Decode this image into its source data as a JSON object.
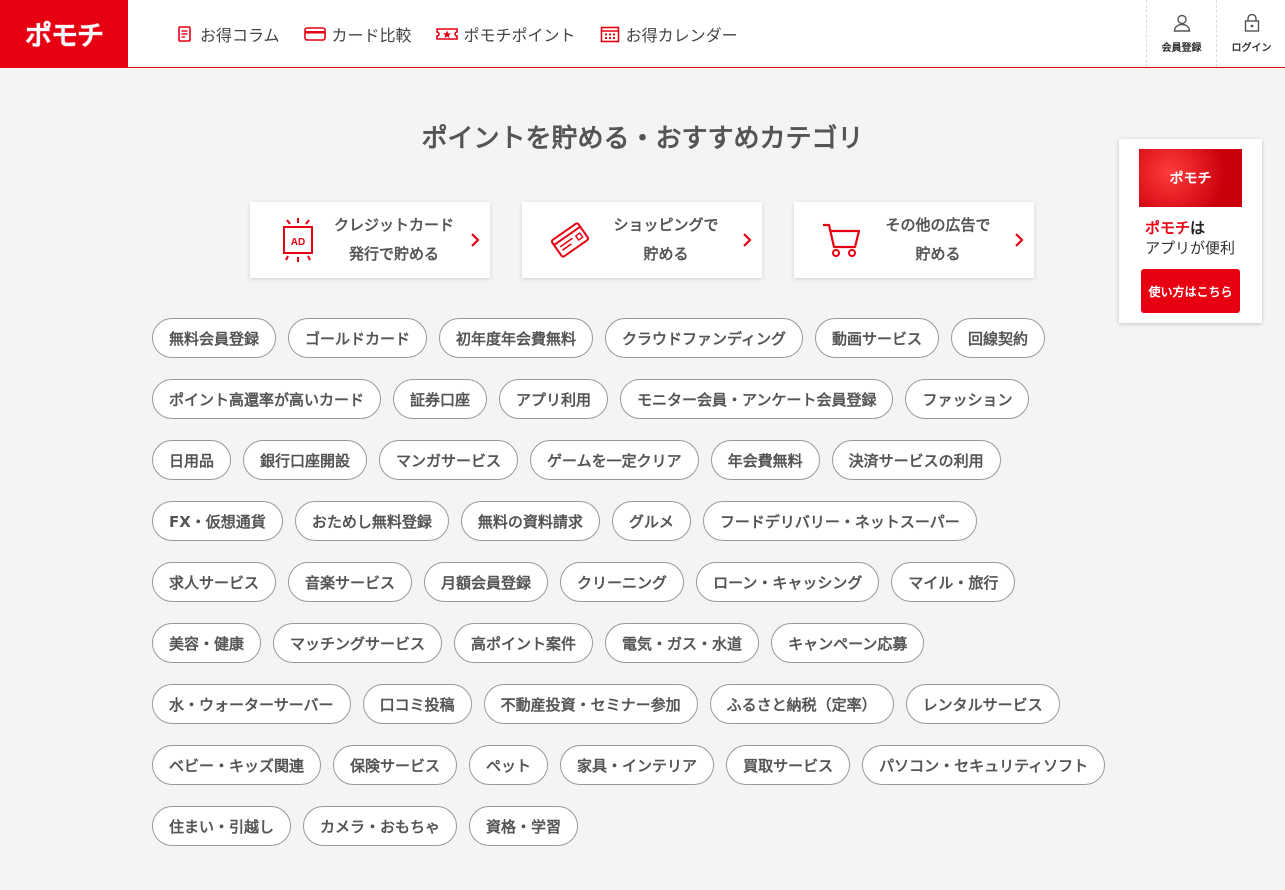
{
  "header": {
    "logo": "ポモチ",
    "nav": [
      {
        "label": "お得コラム",
        "icon": "column-icon"
      },
      {
        "label": "カード比較",
        "icon": "card-icon"
      },
      {
        "label": "ポモチポイント",
        "icon": "ticket-icon"
      },
      {
        "label": "お得カレンダー",
        "icon": "calendar-icon"
      }
    ],
    "register_label": "会員登録",
    "login_label": "ログイン"
  },
  "main": {
    "heading": "ポイントを貯める・おすすめカテゴリ",
    "feature_cards": [
      {
        "label": "クレジットカード\n発行で貯める",
        "icon": "ad-icon"
      },
      {
        "label": "ショッピングで\n貯める",
        "icon": "credit-card-icon"
      },
      {
        "label": "その他の広告で\n貯める",
        "icon": "cart-icon"
      }
    ],
    "tags": [
      "無料会員登録",
      "ゴールドカード",
      "初年度年会費無料",
      "クラウドファンディング",
      "動画サービス",
      "回線契約",
      "ポイント高還率が高いカード",
      "証券口座",
      "アプリ利用",
      "モニター会員・アンケート会員登録",
      "ファッション",
      "日用品",
      "銀行口座開設",
      "マンガサービス",
      "ゲームを一定クリア",
      "年会費無料",
      "決済サービスの利用",
      "FX・仮想通貨",
      "おためし無料登録",
      "無料の資料請求",
      "グルメ",
      "フードデリバリー・ネットスーパー",
      "求人サービス",
      "音楽サービス",
      "月額会員登録",
      "クリーニング",
      "ローン・キャッシング",
      "マイル・旅行",
      "美容・健康",
      "マッチングサービス",
      "高ポイント案件",
      "電気・ガス・水道",
      "キャンペーン応募",
      "水・ウォーターサーバー",
      "口コミ投稿",
      "不動産投資・セミナー参加",
      "ふるさと納税（定率）",
      "レンタルサービス",
      "ベビー・キッズ関連",
      "保険サービス",
      "ペット",
      "家具・インテリア",
      "買取サービス",
      "パソコン・セキュリティソフト",
      "住まい・引越し",
      "カメラ・おもちゃ",
      "資格・学習"
    ]
  },
  "side_ad": {
    "image_text": "ポモチ",
    "brand": "ポモチ",
    "line1_suffix": "は",
    "line2": "アプリが便利",
    "button_label": "使い方はこちら"
  },
  "colors": {
    "accent": "#e60012",
    "background": "#f4f4f4"
  }
}
